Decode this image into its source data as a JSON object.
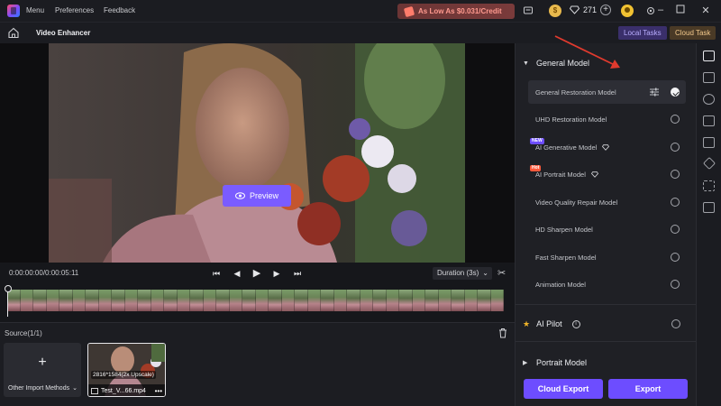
{
  "titlebar": {
    "menu": [
      "Menu",
      "Preferences",
      "Feedback"
    ],
    "promo": "As Low As $0.031/Credit",
    "credits": "271"
  },
  "subbar": {
    "title": "Video Enhancer",
    "local_tasks": "Local Tasks",
    "cloud_task": "Cloud Task"
  },
  "preview": {
    "button_label": "Preview"
  },
  "controls": {
    "timecode": "0:00:00:00/0:00:05:11",
    "duration": "Duration (3s)"
  },
  "source": {
    "label": "Source(1/1)",
    "import_label": "Other Import Methods",
    "clip_resolution": "2816*1584(2x Upscale)",
    "clip_name": "Test_V...66.mp4"
  },
  "panel": {
    "general_model": "General Model",
    "models": [
      {
        "label": "General Restoration Model",
        "selected": true
      },
      {
        "label": "UHD Restoration Model",
        "selected": false
      },
      {
        "label": "AI Generative Model",
        "badge": "NEW",
        "selected": false
      },
      {
        "label": "AI Portrait Model",
        "badge": "Hot",
        "selected": false
      },
      {
        "label": "Video Quality Repair Model",
        "selected": false
      },
      {
        "label": "HD Sharpen Model",
        "selected": false
      },
      {
        "label": "Fast Sharpen Model",
        "selected": false
      },
      {
        "label": "Animation Model",
        "selected": false
      }
    ],
    "ai_pilot": "AI Pilot",
    "portrait_model": "Portrait Model",
    "cloud_export": "Cloud Export",
    "export": "Export"
  },
  "colors": {
    "accent": "#6d4dff",
    "promo_text": "#ff9a8f",
    "background": "#16171b",
    "panel": "#1f2025"
  }
}
